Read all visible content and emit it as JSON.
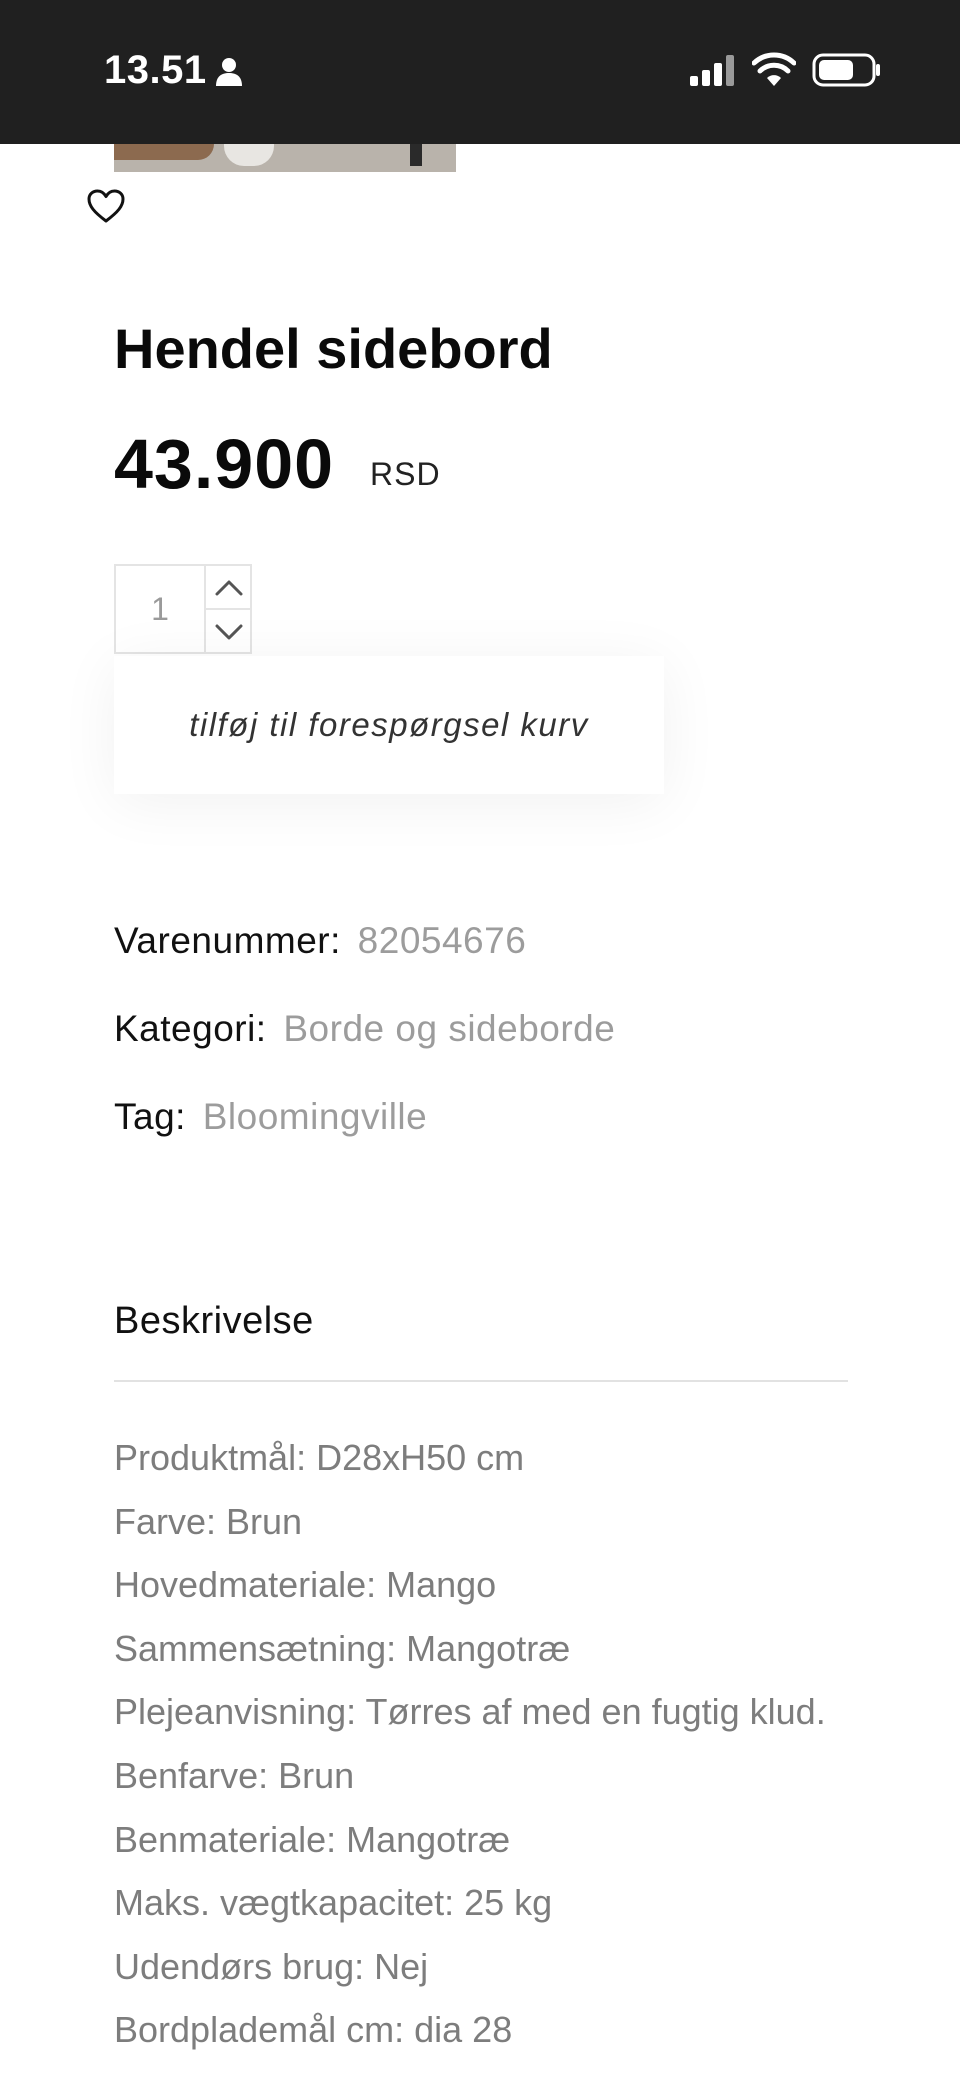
{
  "status_bar": {
    "time": "13.51",
    "icons": [
      "person-icon",
      "signal-icon",
      "wifi-icon",
      "battery-icon"
    ]
  },
  "product": {
    "image_alt_icon": "product-image",
    "wishlist_icon": "heart-icon",
    "title": "Hendel sidebord",
    "price": "43.900",
    "currency": "RSD",
    "quantity": "1",
    "add_to_cart_label": "tilføj til forespørgsel kurv"
  },
  "meta": {
    "sku_label": "Varenummer:",
    "sku_value": "82054676",
    "category_label": "Kategori:",
    "category_value": "Borde og sideborde",
    "tag_label": "Tag:",
    "tag_value": "Bloomingville"
  },
  "description": {
    "heading": "Beskrivelse",
    "items": [
      "Produktmål: D28xH50 cm",
      "Farve: Brun",
      "Hovedmateriale: Mango",
      "Sammensætning: Mangotræ",
      "Plejeanvisning: Tørres af med en fugtig klud.",
      "Benfarve: Brun",
      "Benmateriale: Mangotræ",
      "Maks. vægtkapacitet: 25 kg",
      "Udendørs brug: Nej",
      "Bordplademål cm: dia 28"
    ]
  },
  "colors": {
    "status_bar_bg": "#202020",
    "text_primary": "#111111",
    "text_muted": "#9c9c9c",
    "description_text": "#7d7d7d"
  }
}
